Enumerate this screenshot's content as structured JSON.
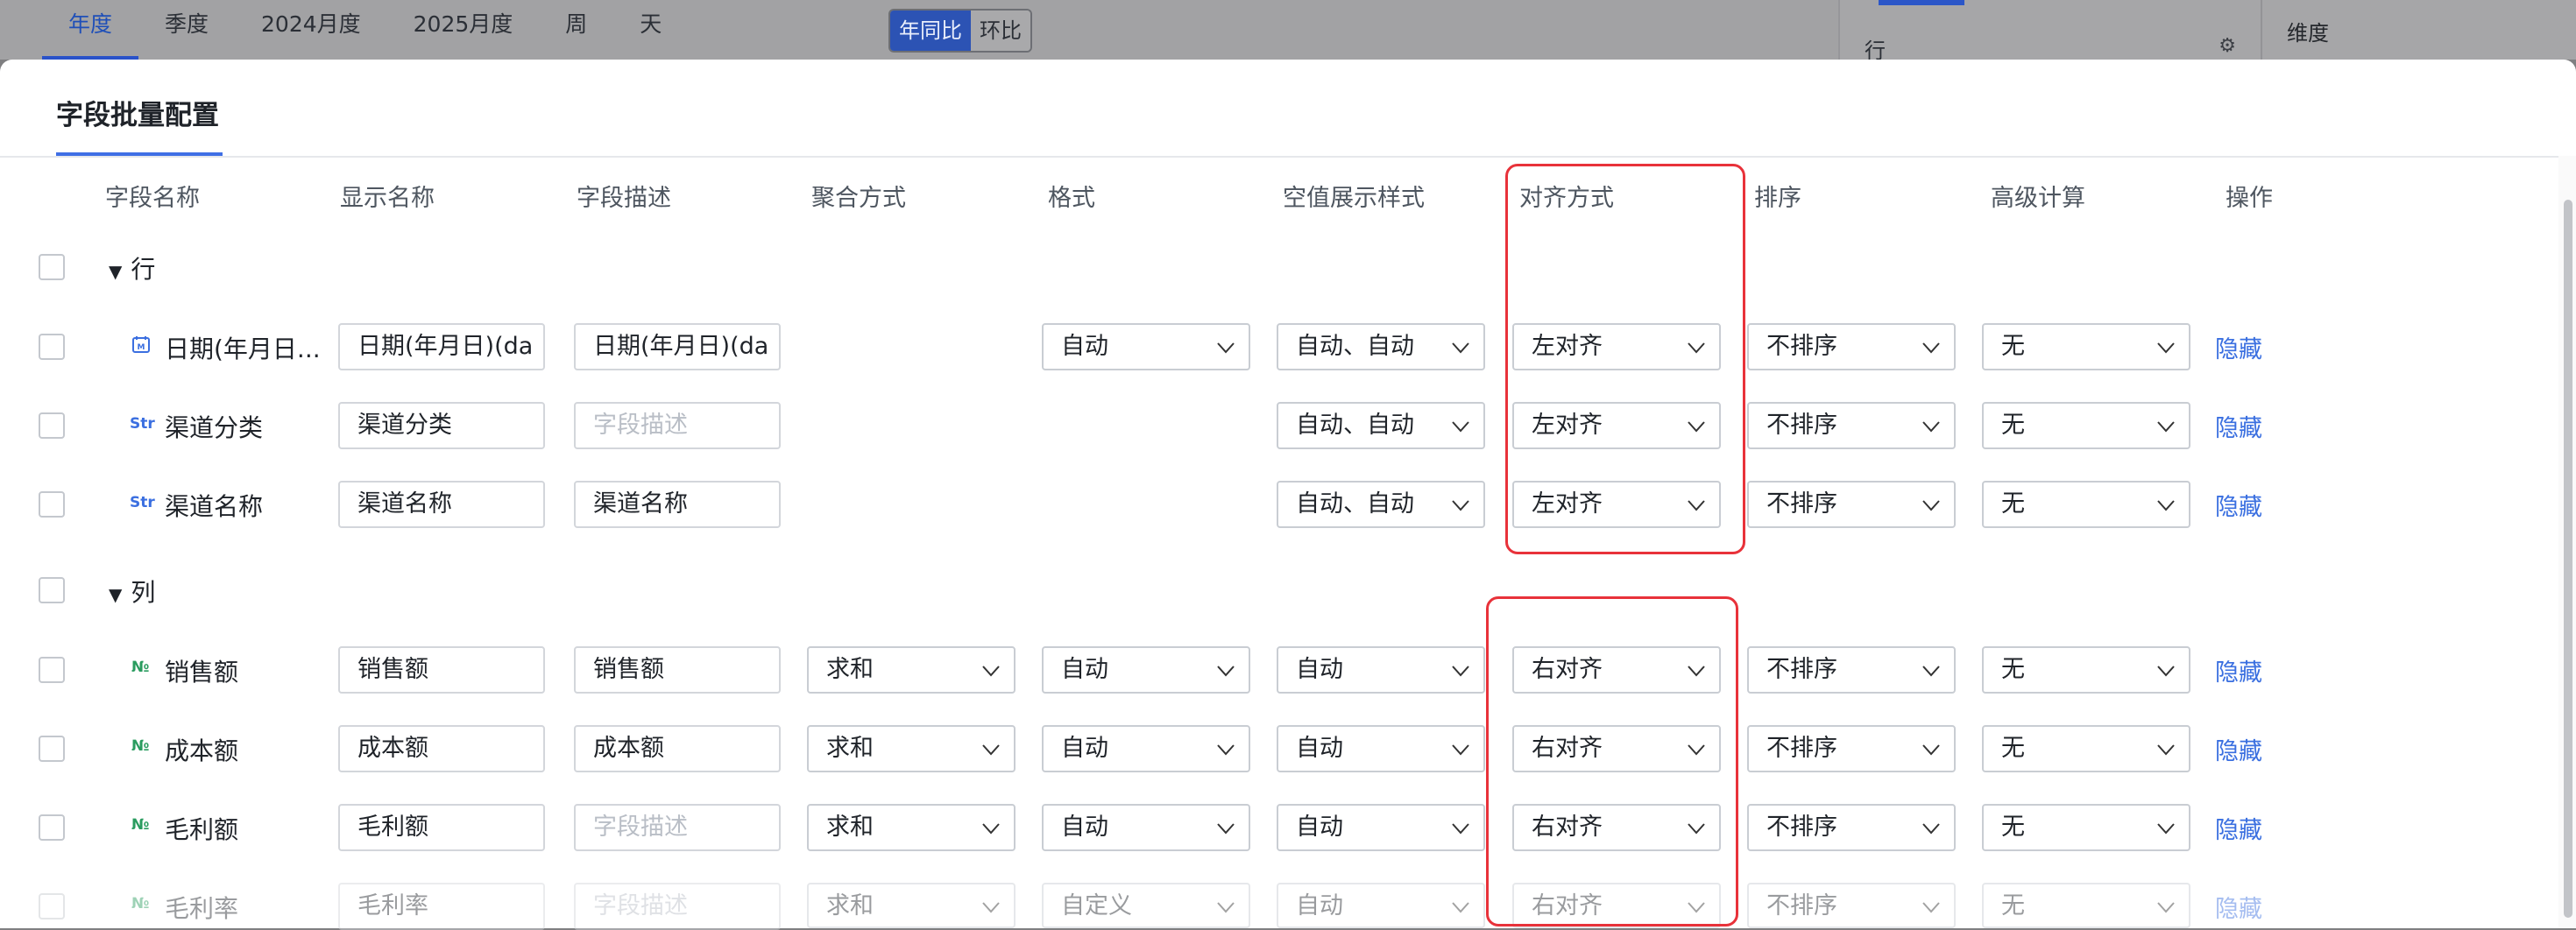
{
  "background": {
    "tabs": [
      "年度",
      "季度",
      "2024月度",
      "2025月度",
      "周",
      "天"
    ],
    "active_tab": "年度",
    "compare_toggle": [
      "年同比",
      "环比"
    ],
    "side_panel": {
      "row_label": "行",
      "dimension_label": "维度"
    }
  },
  "modal": {
    "title": "字段批量配置",
    "columns": [
      "字段名称",
      "显示名称",
      "字段描述",
      "聚合方式",
      "格式",
      "空值展示样式",
      "对齐方式",
      "排序",
      "高级计算",
      "操作"
    ],
    "desc_placeholder": "字段描述",
    "groups": [
      {
        "label": "行",
        "fields": [
          {
            "type": "日期",
            "name": "日期(年月日...",
            "display": "日期(年月日)(da",
            "desc": "日期(年月日)(da",
            "agg": "",
            "format": "自动",
            "null_style": "自动、自动",
            "align": "左对齐",
            "sort": "不排序",
            "calc": "无",
            "action": "隐藏"
          },
          {
            "type": "Str",
            "name": "渠道分类",
            "display": "渠道分类",
            "desc": "",
            "agg": "",
            "format": "",
            "null_style": "自动、自动",
            "align": "左对齐",
            "sort": "不排序",
            "calc": "无",
            "action": "隐藏"
          },
          {
            "type": "Str",
            "name": "渠道名称",
            "display": "渠道名称",
            "desc": "渠道名称",
            "agg": "",
            "format": "",
            "null_style": "自动、自动",
            "align": "左对齐",
            "sort": "不排序",
            "calc": "无",
            "action": "隐藏"
          }
        ]
      },
      {
        "label": "列",
        "fields": [
          {
            "type": "No",
            "name": "销售额",
            "display": "销售额",
            "desc": "销售额",
            "agg": "求和",
            "format": "自动",
            "null_style": "自动",
            "align": "右对齐",
            "sort": "不排序",
            "calc": "无",
            "action": "隐藏"
          },
          {
            "type": "No",
            "name": "成本额",
            "display": "成本额",
            "desc": "成本额",
            "agg": "求和",
            "format": "自动",
            "null_style": "自动",
            "align": "右对齐",
            "sort": "不排序",
            "calc": "无",
            "action": "隐藏"
          },
          {
            "type": "No",
            "name": "毛利额",
            "display": "毛利额",
            "desc": "",
            "agg": "求和",
            "format": "自动",
            "null_style": "自动",
            "align": "右对齐",
            "sort": "不排序",
            "calc": "无",
            "action": "隐藏"
          },
          {
            "type": "No",
            "name": "毛利率",
            "display": "毛利率",
            "desc": "",
            "agg": "求和",
            "format": "自定义",
            "null_style": "自动",
            "align": "右对齐",
            "sort": "不排序",
            "calc": "无",
            "action": "隐藏"
          }
        ]
      }
    ]
  },
  "colors": {
    "accent": "#3a6fe0",
    "highlight": "#e8323a",
    "type_date": "#3b6fe0",
    "type_str": "#3b6fe0",
    "type_num": "#2a9c5f"
  }
}
